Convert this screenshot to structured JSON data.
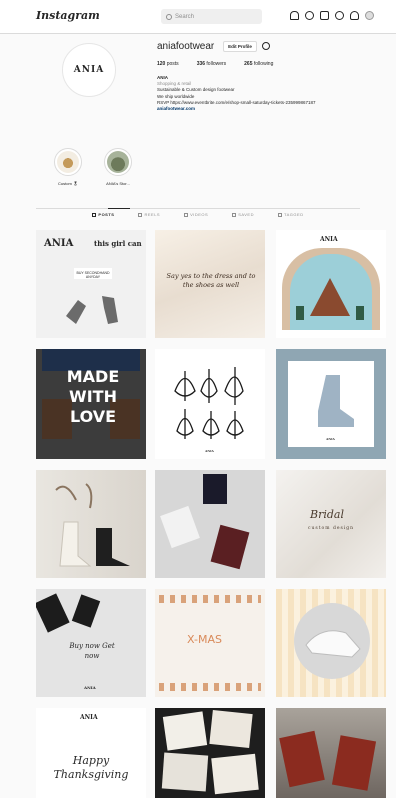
{
  "app": {
    "logo": "Instagram",
    "search_placeholder": "Search"
  },
  "profile": {
    "avatar_text": "ANIA",
    "username": "aniafootwear",
    "edit_label": "Edit Profile",
    "stats": [
      {
        "count": "120",
        "label": "posts"
      },
      {
        "count": "336",
        "label": "followers"
      },
      {
        "count": "265",
        "label": "following"
      }
    ],
    "bio": {
      "name": "ANIA",
      "category": "Shopping & retail",
      "line1": "Sustainable & Custom design footwear",
      "line2": "We ship worldwide",
      "line3": "RSVP https://www.eventbrite.com/e/shop-small-saturday-tickets-235999867187",
      "link": "aniafootwear.com"
    }
  },
  "highlights": [
    {
      "label": "Custom 🎖"
    },
    {
      "label": "ANIA's Stor..."
    }
  ],
  "tabs": [
    {
      "label": "POSTS"
    },
    {
      "label": "REELS"
    },
    {
      "label": "VIDEOS"
    },
    {
      "label": "SAVED"
    },
    {
      "label": "TAGGED"
    }
  ],
  "posts": {
    "p1": {
      "brand": "ANIA",
      "title": "this girl can",
      "line": "BUY SECONDHAND ANYDAY"
    },
    "p2": {
      "text": "Say yes to the dress and to the shoes as well"
    },
    "p3": {
      "brand": "ANIA"
    },
    "p4": {
      "text": "MADE WITH LOVE"
    },
    "p5": {
      "brand": "ANIA"
    },
    "p6": {
      "brand": "ANIA"
    },
    "p9": {
      "title": "Bridal",
      "subtitle": "custom design"
    },
    "p10": {
      "text": "Buy now Get now",
      "brand": "ANIA"
    },
    "p11": {
      "title": "X-MAS"
    },
    "p13": {
      "brand": "ANIA",
      "title": "Happy Thanksgiving"
    }
  }
}
